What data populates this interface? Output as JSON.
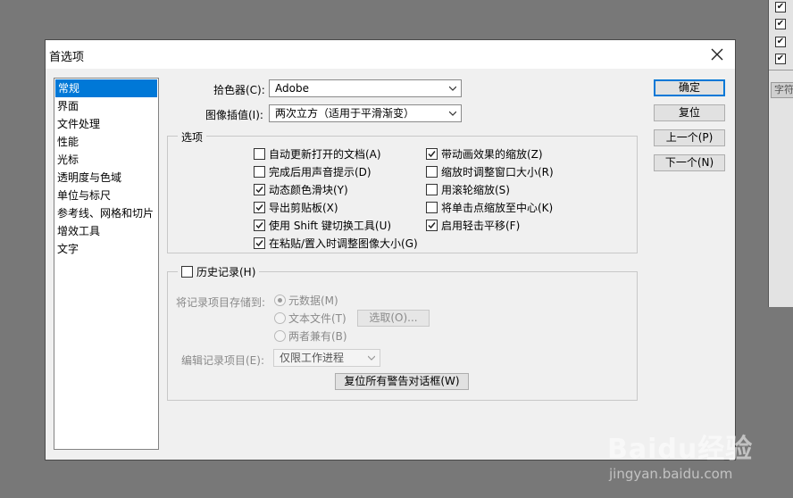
{
  "dialog": {
    "title": "首选项"
  },
  "categories": [
    "常规",
    "界面",
    "文件处理",
    "性能",
    "光标",
    "透明度与色域",
    "单位与标尺",
    "参考线、网格和切片",
    "增效工具",
    "文字"
  ],
  "general": {
    "color_picker_label": "拾色器(C):",
    "color_picker_value": "Adobe",
    "interpolation_label": "图像插值(I):",
    "interpolation_value": "两次立方（适用于平滑渐变）"
  },
  "options": {
    "title": "选项",
    "left": [
      {
        "label": "自动更新打开的文档(A)",
        "checked": false
      },
      {
        "label": "完成后用声音提示(D)",
        "checked": false
      },
      {
        "label": "动态颜色滑块(Y)",
        "checked": true
      },
      {
        "label": "导出剪贴板(X)",
        "checked": true
      },
      {
        "label": "使用 Shift 键切换工具(U)",
        "checked": true
      },
      {
        "label": "在粘贴/置入时调整图像大小(G)",
        "checked": true
      }
    ],
    "right": [
      {
        "label": "带动画效果的缩放(Z)",
        "checked": true
      },
      {
        "label": "缩放时调整窗口大小(R)",
        "checked": false
      },
      {
        "label": "用滚轮缩放(S)",
        "checked": false
      },
      {
        "label": "将单击点缩放至中心(K)",
        "checked": false
      },
      {
        "label": "启用轻击平移(F)",
        "checked": true
      }
    ]
  },
  "history": {
    "title": "历史记录(H)",
    "checked": false,
    "save_to_label": "将记录项目存储到:",
    "radio_metadata": "元数据(M)",
    "radio_textfile": "文本文件(T)",
    "radio_both": "两者兼有(B)",
    "choose_button": "选取(O)...",
    "edit_log_label": "编辑记录项目(E):",
    "edit_log_value": "仅限工作进程"
  },
  "reset_warnings_button": "复位所有警告对话框(W)",
  "buttons": {
    "ok": "确定",
    "reset": "复位",
    "prev": "上一个(P)",
    "next": "下一个(N)"
  },
  "side_panel": {
    "tab_label": "字符"
  },
  "watermark": {
    "logo": "Baidu经验",
    "url": "jingyan.baidu.com"
  },
  "colors": {
    "accent": "#0078d7",
    "dialog_bg": "#f0f0f0",
    "desktop_bg": "#787878"
  }
}
